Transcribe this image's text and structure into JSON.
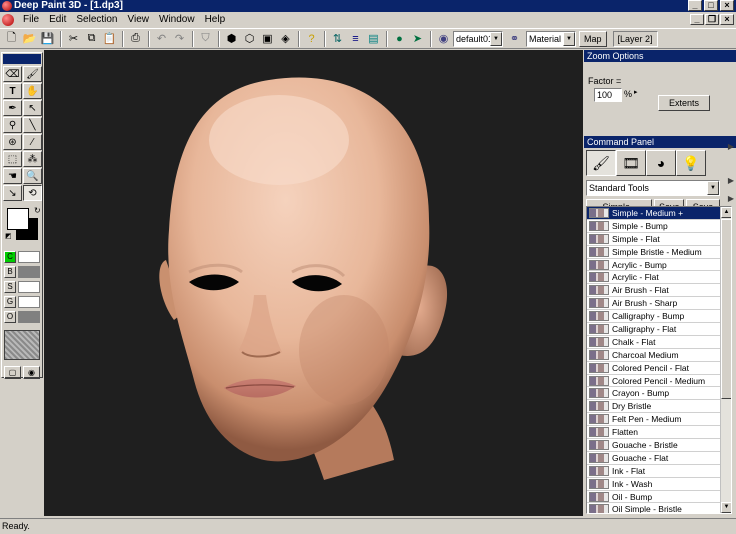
{
  "window": {
    "title": "Deep Paint 3D - [1.dp3]"
  },
  "menu": [
    "File",
    "Edit",
    "Selection",
    "View",
    "Window",
    "Help"
  ],
  "toolbar": {
    "material_set": "default011",
    "material_mode": "Material #",
    "map_label": "Map",
    "layer_label": "[Layer 2]"
  },
  "palette": {
    "channels": [
      {
        "key": "C",
        "color": "#00cc00",
        "bar": "#ffffff"
      },
      {
        "key": "B",
        "color": "#d4d0c8",
        "bar": "#808080"
      },
      {
        "key": "S",
        "color": "#d4d0c8",
        "bar": "#ffffff"
      },
      {
        "key": "G",
        "color": "#d4d0c8",
        "bar": "#ffffff"
      },
      {
        "key": "O",
        "color": "#d4d0c8",
        "bar": "#808080"
      }
    ]
  },
  "zoom": {
    "title": "Zoom Options",
    "factor_label": "Factor =",
    "factor_value": "100",
    "unit": "%",
    "extents_label": "Extents"
  },
  "command_panel": {
    "title": "Command Panel",
    "tool_set": "Standard Tools",
    "preset_name": "Simple - Medium",
    "save_label": "Save",
    "save_as_label": "Save as",
    "brushes": [
      "Simple - Medium +",
      "Simple - Bump",
      "Simple - Flat",
      "Simple Bristle - Medium",
      "Acrylic - Bump",
      "Acrylic - Flat",
      "Air Brush - Flat",
      "Air Brush - Sharp",
      "Calligraphy - Bump",
      "Calligraphy - Flat",
      "Chalk - Flat",
      "Charcoal Medium",
      "Colored Pencil - Flat",
      "Colored Pencil - Medium",
      "Crayon - Bump",
      "Dry Bristle",
      "Felt Pen - Medium",
      "Flatten",
      "Gouache - Bristle",
      "Gouache - Flat",
      "Ink - Flat",
      "Ink - Wash",
      "Oil - Bump",
      "Oil Simple - Bristle"
    ]
  },
  "status": {
    "text": "Ready."
  }
}
